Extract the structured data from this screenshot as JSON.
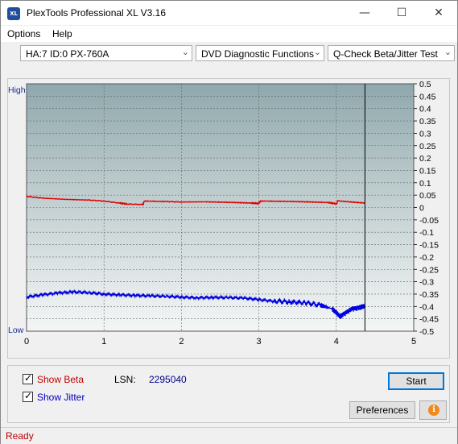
{
  "window": {
    "title": "PlexTools Professional XL V3.16",
    "icon_text": "XL",
    "minimize_icon": "minimize-icon",
    "maximize_icon": "maximize-icon",
    "close_icon": "close-icon"
  },
  "menu": {
    "items": [
      "Options",
      "Help"
    ],
    "underline_letters": [
      "O",
      "H"
    ]
  },
  "toolbar": {
    "drive": "HA:7 ID:0  PX-760A",
    "function": "DVD Diagnostic Functions",
    "test": "Q-Check Beta/Jitter Test"
  },
  "chart_data": {
    "type": "line",
    "left_axis_labels": {
      "top": "High",
      "bottom": "Low"
    },
    "x": {
      "min": 0,
      "max": 5,
      "ticks": [
        "0",
        "1",
        "2",
        "3",
        "4",
        "5"
      ]
    },
    "y_right": {
      "min": -0.5,
      "max": 0.5,
      "ticks": [
        "0.5",
        "0.45",
        "0.4",
        "0.35",
        "0.3",
        "0.25",
        "0.2",
        "0.15",
        "0.1",
        "0.05",
        "0",
        "-0.05",
        "-0.1",
        "-0.15",
        "-0.2",
        "-0.25",
        "-0.3",
        "-0.35",
        "-0.4",
        "-0.45",
        "-0.5"
      ]
    },
    "end_marker_x": 4.37,
    "grid": true,
    "series": [
      {
        "name": "Beta",
        "color": "#e00000",
        "points": [
          [
            0,
            0.045
          ],
          [
            0.2,
            0.038
          ],
          [
            0.5,
            0.033
          ],
          [
            0.8,
            0.03
          ],
          [
            1.0,
            0.026
          ],
          [
            1.2,
            0.018
          ],
          [
            1.3,
            0.014
          ],
          [
            1.5,
            0.012
          ],
          [
            1.52,
            0.026
          ],
          [
            1.8,
            0.024
          ],
          [
            2.0,
            0.022
          ],
          [
            2.3,
            0.023
          ],
          [
            2.6,
            0.021
          ],
          [
            2.9,
            0.018
          ],
          [
            3.0,
            0.016
          ],
          [
            3.02,
            0.026
          ],
          [
            3.3,
            0.025
          ],
          [
            3.6,
            0.023
          ],
          [
            3.9,
            0.02
          ],
          [
            4.0,
            0.015
          ],
          [
            4.02,
            0.027
          ],
          [
            4.2,
            0.022
          ],
          [
            4.37,
            0.018
          ]
        ]
      },
      {
        "name": "Jitter",
        "color": "#0000e0",
        "points": [
          [
            0,
            -0.362
          ],
          [
            0.2,
            -0.352
          ],
          [
            0.4,
            -0.345
          ],
          [
            0.6,
            -0.342
          ],
          [
            0.8,
            -0.345
          ],
          [
            1.0,
            -0.35
          ],
          [
            1.2,
            -0.352
          ],
          [
            1.4,
            -0.355
          ],
          [
            1.6,
            -0.358
          ],
          [
            1.8,
            -0.36
          ],
          [
            2.0,
            -0.362
          ],
          [
            2.2,
            -0.364
          ],
          [
            2.4,
            -0.363
          ],
          [
            2.6,
            -0.365
          ],
          [
            2.8,
            -0.367
          ],
          [
            3.0,
            -0.372
          ],
          [
            3.2,
            -0.378
          ],
          [
            3.4,
            -0.382
          ],
          [
            3.6,
            -0.385
          ],
          [
            3.8,
            -0.395
          ],
          [
            3.95,
            -0.41
          ],
          [
            4.0,
            -0.425
          ],
          [
            4.05,
            -0.44
          ],
          [
            4.1,
            -0.43
          ],
          [
            4.2,
            -0.41
          ],
          [
            4.3,
            -0.405
          ],
          [
            4.37,
            -0.4
          ]
        ]
      }
    ]
  },
  "controls": {
    "show_beta_label": "Show Beta",
    "show_jitter_label": "Show Jitter",
    "show_beta_checked": true,
    "show_jitter_checked": true,
    "show_beta_color": "#c00000",
    "show_jitter_color": "#0000c0",
    "lsn_label": "LSN:",
    "lsn_value": "2295040",
    "start_button": "Start",
    "preferences_button": "Preferences",
    "info_icon": "info-icon"
  },
  "status": {
    "text": "Ready"
  }
}
